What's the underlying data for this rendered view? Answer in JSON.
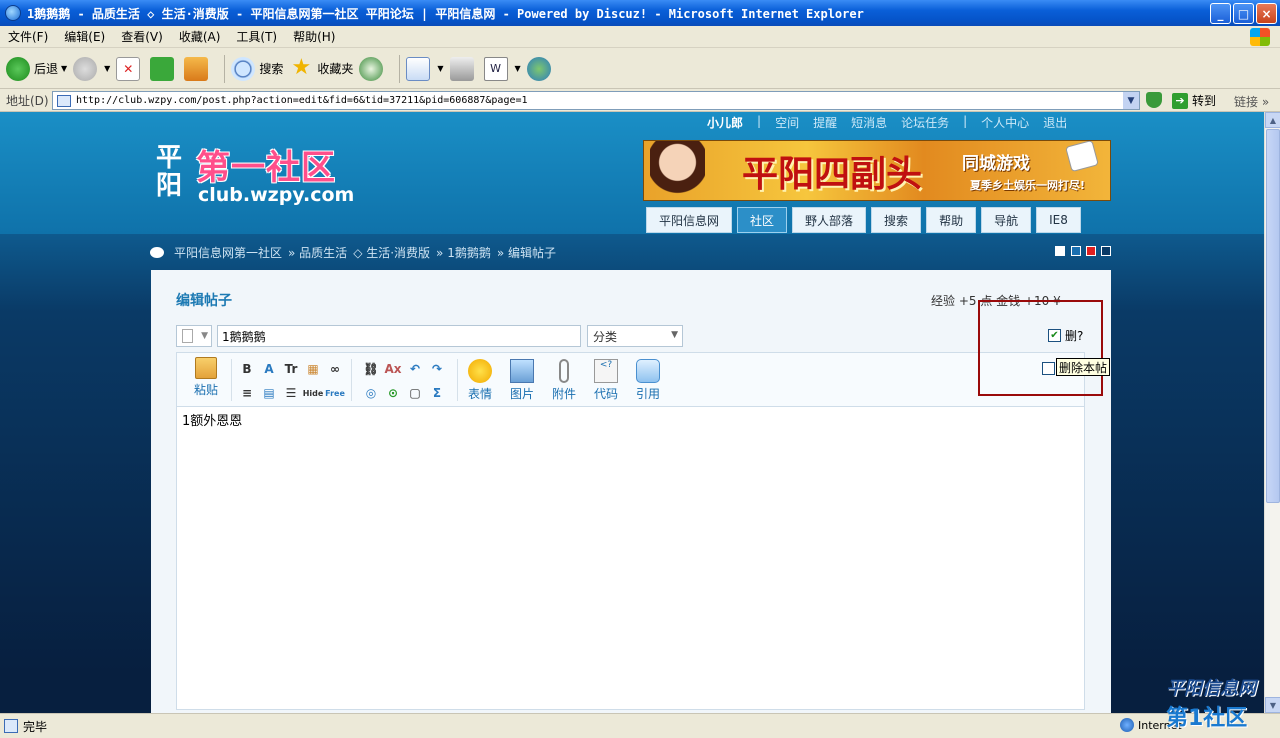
{
  "window": {
    "title": "1鹅鹅鹅 - 品质生活 ◇ 生活·消费版 - 平阳信息网第一社区 平阳论坛 | 平阳信息网 - Powered by Discuz! - Microsoft Internet Explorer",
    "minimize": "_",
    "maximize": "□",
    "close": "×"
  },
  "menu": [
    "文件(F)",
    "编辑(E)",
    "查看(V)",
    "收藏(A)",
    "工具(T)",
    "帮助(H)"
  ],
  "toolbar": {
    "back": "后退",
    "search": "搜索",
    "favorites": "收藏夹"
  },
  "address": {
    "label": "地址(D)",
    "url": "http://club.wzpy.com/post.php?action=edit&fid=6&tid=37211&pid=606887&page=1",
    "go": "转到",
    "links": "链接"
  },
  "topnav": {
    "user": "小儿郎",
    "items": [
      "空间",
      "提醒",
      "短消息",
      "论坛任务",
      "个人中心",
      "退出"
    ]
  },
  "logo": {
    "pinyang": "平阳",
    "main": "第一社区",
    "domain": "club.wzpy.com"
  },
  "banner": {
    "title": "平阳四副头",
    "city_game": "同城游戏",
    "slogan": "夏季乡土娱乐一网打尽!"
  },
  "navtabs": [
    "平阳信息网",
    "社区",
    "野人部落",
    "搜索",
    "帮助",
    "导航",
    "IE8"
  ],
  "breadcrumb": [
    "平阳信息网第一社区",
    "» 品质生活",
    "◇ 生活·消费版",
    "» 1鹅鹅鹅",
    "» 编辑帖子"
  ],
  "panel": {
    "title": "编辑帖子",
    "reward": "经验 +5 点  金钱 +10 ¥",
    "subject_value": "1鹅鹅鹅",
    "category_value": "分类"
  },
  "editor": {
    "paste": "粘贴",
    "buttons": [
      "表情",
      "图片",
      "附件",
      "代码",
      "引用"
    ],
    "icons_row1": [
      "B",
      "A",
      "Tr",
      "▦",
      "∞",
      "⛓",
      "Ax",
      "↶",
      "↷"
    ],
    "icons_row2": [
      "≡",
      "▤",
      "☰",
      "Hide",
      "Free",
      "◎",
      "⊙",
      "▢",
      "Σ"
    ],
    "content": "1额外恩恩"
  },
  "side": {
    "checkbox1_label": "删?",
    "checkbox2_label": "删除本帖",
    "tooltip": "删除本帖"
  },
  "status": {
    "text": "完毕",
    "zone": "Internet"
  },
  "watermark": {
    "line1": "平阳信息网",
    "line2": "第1社区"
  }
}
